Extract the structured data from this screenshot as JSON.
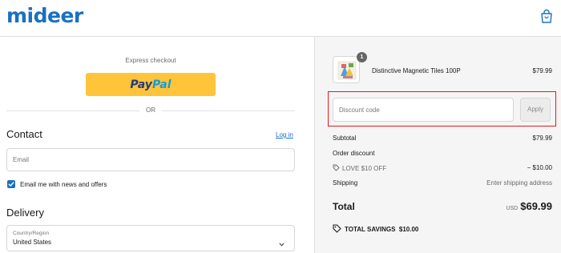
{
  "header": {
    "logo_text": "mideer",
    "cart_icon": "shopping-bag-icon",
    "brand_color": "#1a70c1"
  },
  "checkout": {
    "express_label": "Express checkout",
    "paypal_label_pay": "Pay",
    "paypal_label_pal": "Pal",
    "paypal_color": "#ffc439",
    "or_label": "OR"
  },
  "contact": {
    "title": "Contact",
    "login_link": "Log in",
    "email_placeholder": "Email",
    "email_value": "",
    "newsletter_checked": true,
    "newsletter_label": "Email me with news and offers"
  },
  "delivery": {
    "title": "Delivery",
    "country_label": "Country/Region",
    "country_value": "United States"
  },
  "order_summary": {
    "product": {
      "name": "Distinctive Magnetic Tiles 100P",
      "price": "$79.99",
      "quantity": "1"
    },
    "discount": {
      "placeholder": "Discount code",
      "value": "",
      "apply_label": "Apply",
      "highlight_color": "#e21b1b"
    },
    "subtotal_label": "Subtotal",
    "subtotal_value": "$79.99",
    "order_discount_label": "Order discount",
    "discount_code": "LOVE $10 OFF",
    "discount_value": "− $10.00",
    "shipping_label": "Shipping",
    "shipping_value": "Enter shipping address",
    "total_label": "Total",
    "total_currency": "USD",
    "total_value": "$69.99",
    "savings_label": "TOTAL SAVINGS",
    "savings_value": "$10.00"
  }
}
